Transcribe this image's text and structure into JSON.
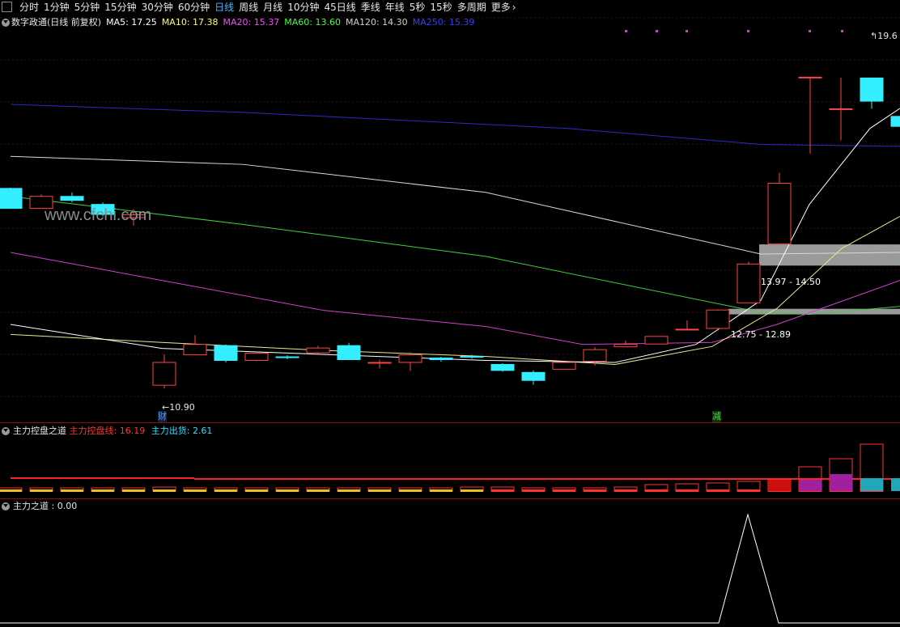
{
  "toolbar": {
    "items": [
      "分时",
      "1分钟",
      "5分钟",
      "15分钟",
      "30分钟",
      "60分钟",
      "日线",
      "周线",
      "月线",
      "10分钟",
      "45日线",
      "季线",
      "年线",
      "5秒",
      "15秒",
      "多周期",
      "更多"
    ],
    "active": "日线"
  },
  "main_panel": {
    "title": "数字政通(日线 前复权)",
    "indicators": [
      {
        "name": "MA5",
        "value": "17.25",
        "color": "#ffffff"
      },
      {
        "name": "MA10",
        "value": "17.38",
        "color": "#ffff66"
      },
      {
        "name": "MA20",
        "value": "15.37",
        "color": "#ff44ff"
      },
      {
        "name": "MA60",
        "value": "13.60",
        "color": "#44ff44"
      },
      {
        "name": "MA120",
        "value": "14.30",
        "color": "#cfcfcf"
      },
      {
        "name": "MA250",
        "value": "15.39",
        "color": "#3a3aff"
      }
    ],
    "watermark": "www.cfchi.com",
    "low_label": "10.90",
    "high_label": "19.6",
    "gap_upper": "13.97 - 14.50",
    "gap_lower": "12.75 - 12.89",
    "marker_cai": "财",
    "marker_jian": "减"
  },
  "panel2": {
    "title": "主力控盘之道",
    "line1_name": "主力控盘线:",
    "line1_value": "16.19",
    "line2_name": "主力出货:",
    "line2_value": "2.61",
    "colors": {
      "line1": "#ff3333",
      "line2": "#33ddff"
    }
  },
  "panel3": {
    "title": "主力之道",
    "value": ": 0.00"
  },
  "chart_data": {
    "type": "candlestick",
    "candles": [
      {
        "o": 15.9,
        "c": 15.4,
        "h": 15.92,
        "l": 15.4
      },
      {
        "o": 15.4,
        "c": 15.7,
        "h": 15.75,
        "l": 15.4
      },
      {
        "o": 15.7,
        "c": 15.6,
        "h": 15.8,
        "l": 15.55
      },
      {
        "o": 15.5,
        "c": 15.25,
        "h": 15.55,
        "l": 15.2
      },
      {
        "o": 15.17,
        "c": 15.24,
        "h": 15.38,
        "l": 14.97
      },
      {
        "o": 10.98,
        "c": 11.55,
        "h": 11.75,
        "l": 10.9
      },
      {
        "o": 11.74,
        "c": 12.0,
        "h": 12.23,
        "l": 11.74
      },
      {
        "o": 11.97,
        "c": 11.6,
        "h": 12.0,
        "l": 11.55
      },
      {
        "o": 11.6,
        "c": 11.78,
        "h": 11.78,
        "l": 11.58
      },
      {
        "o": 11.69,
        "c": 11.67,
        "h": 11.73,
        "l": 11.63
      },
      {
        "o": 11.79,
        "c": 11.91,
        "h": 11.97,
        "l": 11.76
      },
      {
        "o": 11.97,
        "c": 11.62,
        "h": 12.04,
        "l": 11.62
      },
      {
        "o": 11.55,
        "c": 11.55,
        "h": 11.62,
        "l": 11.4
      },
      {
        "o": 11.55,
        "c": 11.74,
        "h": 11.8,
        "l": 11.34
      },
      {
        "o": 11.66,
        "c": 11.62,
        "h": 11.69,
        "l": 11.57
      },
      {
        "o": 11.7,
        "c": 11.68,
        "h": 11.74,
        "l": 11.64
      },
      {
        "o": 11.5,
        "c": 11.35,
        "h": 11.53,
        "l": 11.32
      },
      {
        "o": 11.3,
        "c": 11.1,
        "h": 11.35,
        "l": 10.99
      },
      {
        "o": 11.38,
        "c": 11.55,
        "h": 11.56,
        "l": 11.38
      },
      {
        "o": 11.58,
        "c": 11.87,
        "h": 11.93,
        "l": 11.47
      },
      {
        "o": 11.94,
        "c": 12.0,
        "h": 12.1,
        "l": 11.94
      },
      {
        "o": 12.01,
        "c": 12.2,
        "h": 12.2,
        "l": 12.01
      },
      {
        "o": 12.38,
        "c": 12.38,
        "h": 12.6,
        "l": 12.38
      },
      {
        "o": 12.4,
        "c": 12.86,
        "h": 12.88,
        "l": 12.4
      },
      {
        "o": 13.04,
        "c": 14.01,
        "h": 14.07,
        "l": 13.04
      },
      {
        "o": 14.51,
        "c": 16.03,
        "h": 16.29,
        "l": 14.51
      },
      {
        "o": 18.68,
        "c": 18.68,
        "h": 18.68,
        "l": 16.77
      },
      {
        "o": 17.89,
        "c": 17.89,
        "h": 18.67,
        "l": 17.1
      },
      {
        "o": 18.66,
        "c": 18.08,
        "h": 18.67,
        "l": 17.89
      },
      {
        "o": 17.7,
        "c": 17.45,
        "h": 17.72,
        "l": 17.4
      }
    ]
  }
}
